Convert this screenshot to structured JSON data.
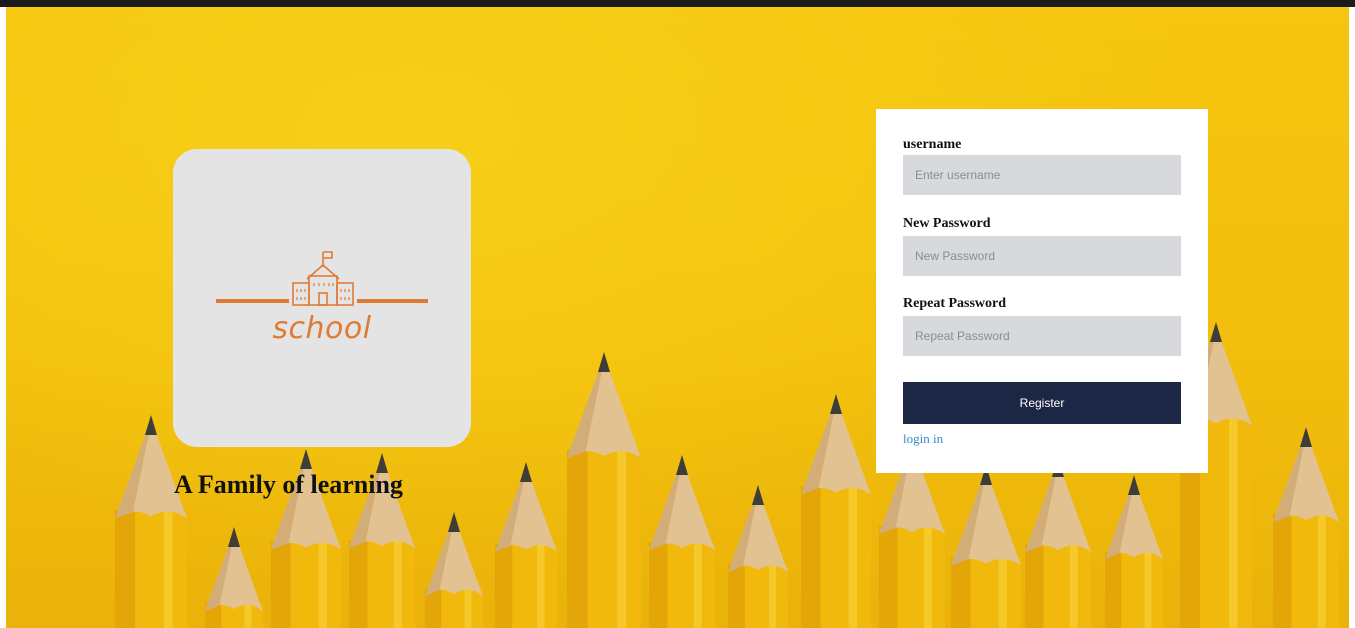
{
  "brand": {
    "logo_text": "school",
    "tagline": "A Family of learning",
    "accent_color": "#e07b35",
    "logo_icon": "school-building-icon"
  },
  "form": {
    "username": {
      "label": "username",
      "placeholder": "Enter username",
      "value": ""
    },
    "new_password": {
      "label": "New Password",
      "placeholder": "New Password",
      "value": ""
    },
    "repeat_password": {
      "label": "Repeat Password",
      "placeholder": "Repeat Password",
      "value": ""
    },
    "register_label": "Register",
    "login_link": "login in",
    "button_color": "#1b2745",
    "link_color": "#2f8fc9"
  },
  "background": {
    "image": "yellow-pencils-photo",
    "color": "#f5c50f"
  }
}
